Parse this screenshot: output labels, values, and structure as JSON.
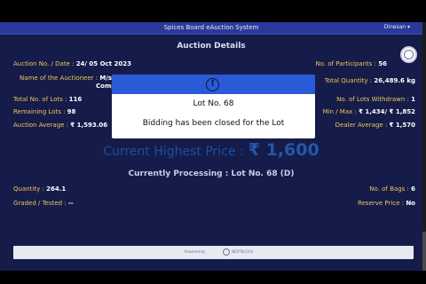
{
  "header": {
    "title": "Spices Board eAuction System",
    "user_menu": "Dinesan ▾"
  },
  "section_title": "Auction Details",
  "auction": {
    "auction_no_label": "Auction No. / Date :",
    "auction_no_value": "24/ 05 Oct 2023",
    "participants_label": "No. of Participants :",
    "participants_value": "56",
    "auctioneer_label": "Name of the Auctioneer :",
    "auctioneer_value": "M/s",
    "auctioneer_value_cont": "Comp",
    "total_qty_label": "Total Quantity :",
    "total_qty_value": "26,489.6 kg",
    "total_lots_label": "Total No. of Lots :",
    "total_lots_value": "116",
    "lots_withdrawn_label": "No. of Lots Withdrawn :",
    "lots_withdrawn_value": "1",
    "remaining_lots_label": "Remaining Lots :",
    "remaining_lots_value": "98",
    "min_max_label": "Min / Max :",
    "min_max_value": "₹ 1,434/ ₹ 1,852",
    "auction_avg_label": "Auction Average :",
    "auction_avg_value": "₹ 1,593.06",
    "dealer_avg_label": "Dealer Average :",
    "dealer_avg_value": "₹ 1,570"
  },
  "highest": {
    "label": "Current Highest Price :",
    "value": "₹ 1,600"
  },
  "processing": "Currently Processing : Lot No. 68 (D)",
  "lot": {
    "quantity_label": "Quantity :",
    "quantity_value": "264.1",
    "bags_label": "No. of Bags :",
    "bags_value": "6",
    "graded_label": "Graded / Tested :",
    "graded_value": "--",
    "reserve_label": "Reserve Price :",
    "reserve_value": "No"
  },
  "footer": {
    "powered_by": "Powered by",
    "brand": "NEXTBLOCK"
  },
  "modal": {
    "icon": "!",
    "title": "Lot No. 68",
    "message": "Bidding has been closed for the Lot"
  },
  "colors": {
    "background": "#151c4a",
    "header": "#2b3a9a",
    "label": "#f2c35a",
    "value": "#ffffff",
    "highest_price": "#2556aa",
    "modal_header": "#2b5ad6"
  }
}
